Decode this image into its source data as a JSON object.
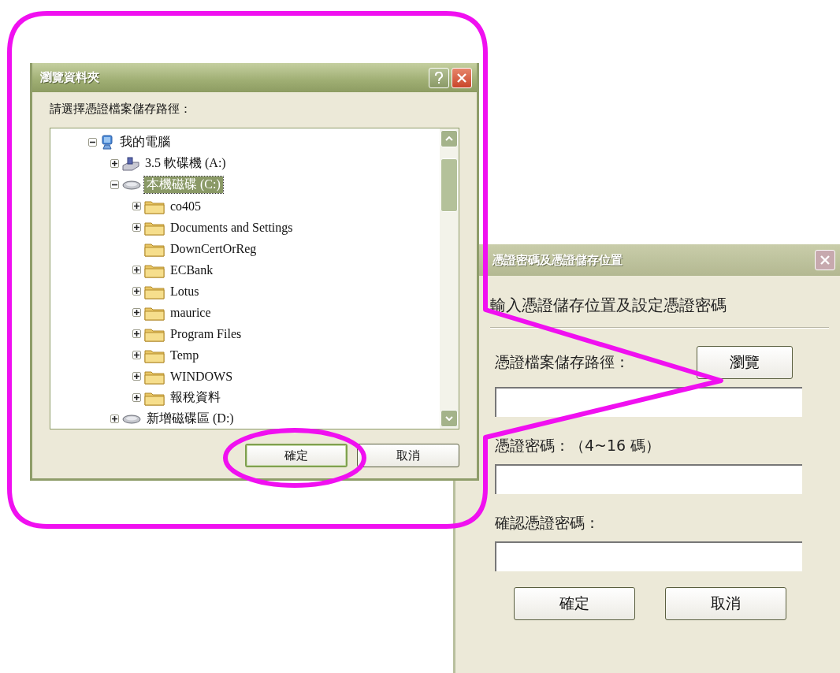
{
  "browse_dialog": {
    "title": "瀏覽資料夾",
    "prompt": "請選擇憑證檔案儲存路徑：",
    "tree": [
      {
        "label": "我的電腦",
        "kind": "computer",
        "has_children": true,
        "expanded": true,
        "selected": false,
        "children": [
          {
            "label": "3.5 軟碟機 (A:)",
            "kind": "floppy",
            "has_children": true,
            "expanded": false,
            "selected": false
          },
          {
            "label": "本機磁碟 (C:)",
            "kind": "drive",
            "has_children": true,
            "expanded": true,
            "selected": true,
            "children": [
              {
                "label": "co405",
                "kind": "folder",
                "has_children": true,
                "expanded": false,
                "selected": false
              },
              {
                "label": "Documents and Settings",
                "kind": "folder",
                "has_children": true,
                "expanded": false,
                "selected": false
              },
              {
                "label": "DownCertOrReg",
                "kind": "folder",
                "has_children": false,
                "selected": false
              },
              {
                "label": "ECBank",
                "kind": "folder",
                "has_children": true,
                "expanded": false,
                "selected": false
              },
              {
                "label": "Lotus",
                "kind": "folder",
                "has_children": true,
                "expanded": false,
                "selected": false
              },
              {
                "label": "maurice",
                "kind": "folder",
                "has_children": true,
                "expanded": false,
                "selected": false
              },
              {
                "label": "Program Files",
                "kind": "folder",
                "has_children": true,
                "expanded": false,
                "selected": false
              },
              {
                "label": "Temp",
                "kind": "folder",
                "has_children": true,
                "expanded": false,
                "selected": false
              },
              {
                "label": "WINDOWS",
                "kind": "folder",
                "has_children": true,
                "expanded": false,
                "selected": false
              },
              {
                "label": "報稅資料",
                "kind": "folder",
                "has_children": true,
                "expanded": false,
                "selected": false
              }
            ]
          },
          {
            "label": "新增磁碟區 (D:)",
            "kind": "drive",
            "has_children": true,
            "expanded": false,
            "selected": false
          }
        ]
      }
    ],
    "buttons": [
      {
        "label": "確定",
        "default": true
      },
      {
        "label": "取消",
        "default": false
      }
    ]
  },
  "cert_dialog": {
    "title": "憑證密碼及憑證儲存位置",
    "heading": "輸入憑證儲存位置及設定憑證密碼",
    "path_label": "憑證檔案儲存路徑：",
    "browse_button": "瀏覽",
    "password_label": "憑證密碼：（4~16 碼）",
    "confirm_label": "確認憑證密碼：",
    "buttons": [
      "確定",
      "取消"
    ]
  }
}
